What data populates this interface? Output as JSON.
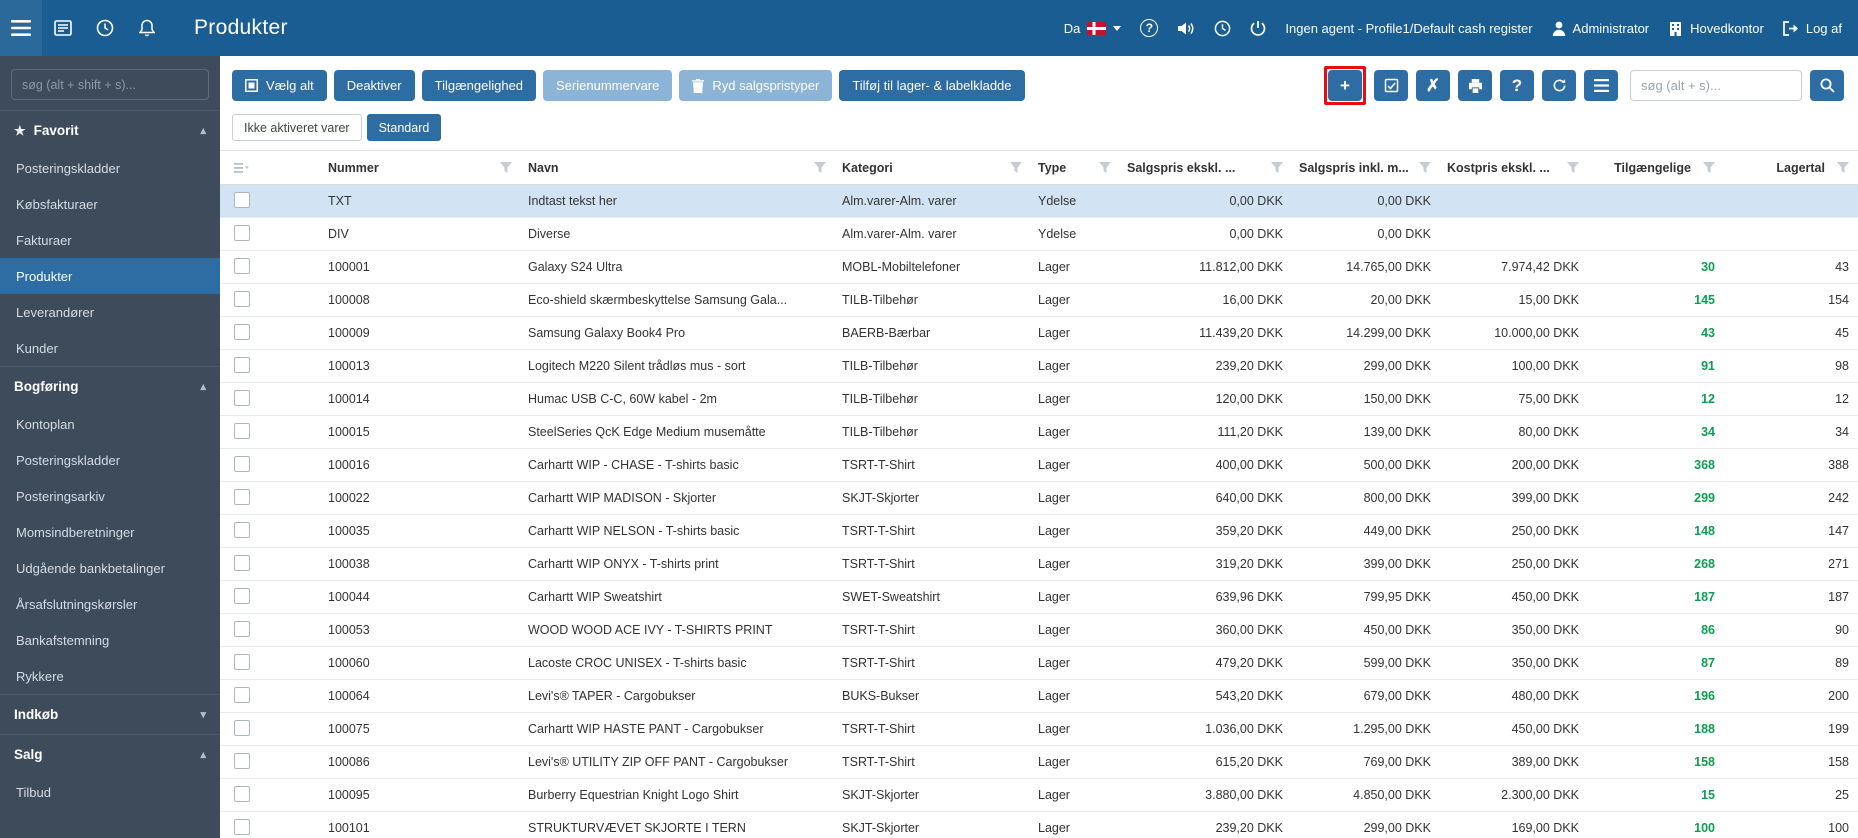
{
  "colors": {
    "topbar": "#1a5d92",
    "sidebar": "#3e4b5b",
    "accent": "#2e6da4",
    "accent_light": "#8cb4d6",
    "positive_stock": "#0c9e53",
    "selected_row": "#d2e4f3",
    "highlight_annotation": "#e80c0c"
  },
  "topbar": {
    "title": "Produkter",
    "language": "Da",
    "agent_status": "Ingen agent - Profile1/Default cash register",
    "user": "Administrator",
    "location": "Hovedkontor",
    "logout_label": "Log af",
    "left_icons": [
      "menu-icon",
      "news-icon",
      "clock-icon",
      "bell-icon"
    ],
    "right_icons": [
      "help-icon",
      "speaker-icon",
      "clock-icon",
      "power-icon"
    ]
  },
  "sidebar": {
    "search_placeholder": "søg (alt + shift + s)...",
    "sections": [
      {
        "label": "Favorit",
        "icon": "star",
        "expanded": true,
        "items": [
          {
            "label": "Posteringskladder"
          },
          {
            "label": "Købsfakturaer"
          },
          {
            "label": "Fakturaer"
          },
          {
            "label": "Produkter",
            "active": true
          },
          {
            "label": "Leverandører"
          },
          {
            "label": "Kunder"
          }
        ]
      },
      {
        "label": "Bogføring",
        "expanded": true,
        "items": [
          {
            "label": "Kontoplan"
          },
          {
            "label": "Posteringskladder"
          },
          {
            "label": "Posteringsarkiv"
          },
          {
            "label": "Momsindberetninger"
          },
          {
            "label": "Udgående bankbetalinger"
          },
          {
            "label": "Årsafslutningskørsler"
          },
          {
            "label": "Bankafstemning"
          },
          {
            "label": "Rykkere"
          }
        ]
      },
      {
        "label": "Indkøb",
        "expanded": false,
        "items": []
      },
      {
        "label": "Salg",
        "expanded": true,
        "items": [
          {
            "label": "Tilbud"
          }
        ]
      }
    ]
  },
  "toolbar": {
    "buttons": [
      {
        "label": "Vælg alt",
        "variant": "dark",
        "icon": "select-all"
      },
      {
        "label": "Deaktiver",
        "variant": "dark"
      },
      {
        "label": "Tilgængelighed",
        "variant": "dark"
      },
      {
        "label": "Serienummervare",
        "variant": "light"
      },
      {
        "label": "Ryd salgspristyper",
        "variant": "light",
        "icon": "trash"
      },
      {
        "label": "Tilføj til lager- & labelkladde",
        "variant": "dark"
      }
    ],
    "action_buttons": [
      {
        "name": "add",
        "highlighted": true
      },
      {
        "name": "edit"
      },
      {
        "name": "clear"
      },
      {
        "name": "print"
      },
      {
        "name": "help"
      },
      {
        "name": "refresh"
      },
      {
        "name": "columns"
      }
    ],
    "search_placeholder": "søg (alt + s)..."
  },
  "view_tabs": [
    {
      "label": "Ikke aktiveret varer",
      "active": false
    },
    {
      "label": "Standard",
      "active": true
    }
  ],
  "table": {
    "selected_row_index": 0,
    "columns": [
      "Nummer",
      "Navn",
      "Kategori",
      "Type",
      "Salgspris ekskl. ...",
      "Salgspris inkl. m...",
      "Kostpris ekskl. ...",
      "Tilgængelige",
      "Lagertal"
    ],
    "rows": [
      [
        "TXT",
        "Indtast tekst her",
        "Alm.varer-Alm. varer",
        "Ydelse",
        "0,00 DKK",
        "0,00 DKK",
        "",
        "",
        ""
      ],
      [
        "DIV",
        "Diverse",
        "Alm.varer-Alm. varer",
        "Ydelse",
        "0,00 DKK",
        "0,00 DKK",
        "",
        "",
        ""
      ],
      [
        "100001",
        "Galaxy S24 Ultra",
        "MOBL-Mobiltelefoner",
        "Lager",
        "11.812,00 DKK",
        "14.765,00 DKK",
        "7.974,42 DKK",
        "30",
        "43"
      ],
      [
        "100008",
        "Eco-shield skærmbeskyttelse Samsung Gala...",
        "TILB-Tilbehør",
        "Lager",
        "16,00 DKK",
        "20,00 DKK",
        "15,00 DKK",
        "145",
        "154"
      ],
      [
        "100009",
        "Samsung Galaxy Book4 Pro",
        "BAERB-Bærbar",
        "Lager",
        "11.439,20 DKK",
        "14.299,00 DKK",
        "10.000,00 DKK",
        "43",
        "45"
      ],
      [
        "100013",
        "Logitech M220 Silent trådløs mus - sort",
        "TILB-Tilbehør",
        "Lager",
        "239,20 DKK",
        "299,00 DKK",
        "100,00 DKK",
        "91",
        "98"
      ],
      [
        "100014",
        "Humac USB C-C, 60W kabel - 2m",
        "TILB-Tilbehør",
        "Lager",
        "120,00 DKK",
        "150,00 DKK",
        "75,00 DKK",
        "12",
        "12"
      ],
      [
        "100015",
        "SteelSeries QcK Edge Medium musemåtte",
        "TILB-Tilbehør",
        "Lager",
        "111,20 DKK",
        "139,00 DKK",
        "80,00 DKK",
        "34",
        "34"
      ],
      [
        "100016",
        "Carhartt WIP - CHASE - T-shirts basic",
        "TSRT-T-Shirt",
        "Lager",
        "400,00 DKK",
        "500,00 DKK",
        "200,00 DKK",
        "368",
        "388"
      ],
      [
        "100022",
        "Carhartt WIP MADISON - Skjorter",
        "SKJT-Skjorter",
        "Lager",
        "640,00 DKK",
        "800,00 DKK",
        "399,00 DKK",
        "299",
        "242"
      ],
      [
        "100035",
        "Carhartt WIP NELSON - T-shirts basic",
        "TSRT-T-Shirt",
        "Lager",
        "359,20 DKK",
        "449,00 DKK",
        "250,00 DKK",
        "148",
        "147"
      ],
      [
        "100038",
        "Carhartt WIP ONYX - T-shirts print",
        "TSRT-T-Shirt",
        "Lager",
        "319,20 DKK",
        "399,00 DKK",
        "250,00 DKK",
        "268",
        "271"
      ],
      [
        "100044",
        "Carhartt WIP Sweatshirt",
        "SWET-Sweatshirt",
        "Lager",
        "639,96 DKK",
        "799,95 DKK",
        "450,00 DKK",
        "187",
        "187"
      ],
      [
        "100053",
        "WOOD WOOD ACE IVY - T-SHIRTS PRINT",
        "TSRT-T-Shirt",
        "Lager",
        "360,00 DKK",
        "450,00 DKK",
        "350,00 DKK",
        "86",
        "90"
      ],
      [
        "100060",
        "Lacoste CROC UNISEX - T-shirts basic",
        "TSRT-T-Shirt",
        "Lager",
        "479,20 DKK",
        "599,00 DKK",
        "350,00 DKK",
        "87",
        "89"
      ],
      [
        "100064",
        "Levi's® TAPER - Cargobukser",
        "BUKS-Bukser",
        "Lager",
        "543,20 DKK",
        "679,00 DKK",
        "480,00 DKK",
        "196",
        "200"
      ],
      [
        "100075",
        "Carhartt WIP HASTE PANT - Cargobukser",
        "TSRT-T-Shirt",
        "Lager",
        "1.036,00 DKK",
        "1.295,00 DKK",
        "450,00 DKK",
        "188",
        "199"
      ],
      [
        "100086",
        "Levi's® UTILITY ZIP OFF PANT - Cargobukser",
        "TSRT-T-Shirt",
        "Lager",
        "615,20 DKK",
        "769,00 DKK",
        "389,00 DKK",
        "158",
        "158"
      ],
      [
        "100095",
        "Burberry Equestrian Knight Logo Shirt",
        "SKJT-Skjorter",
        "Lager",
        "3.880,00 DKK",
        "4.850,00 DKK",
        "2.300,00 DKK",
        "15",
        "25"
      ],
      [
        "100101",
        "STRUKTURVÆVET SKJORTE I TERN",
        "SKJT-Skjorter",
        "Lager",
        "239,20 DKK",
        "299,00 DKK",
        "169,00 DKK",
        "100",
        "100"
      ]
    ]
  }
}
